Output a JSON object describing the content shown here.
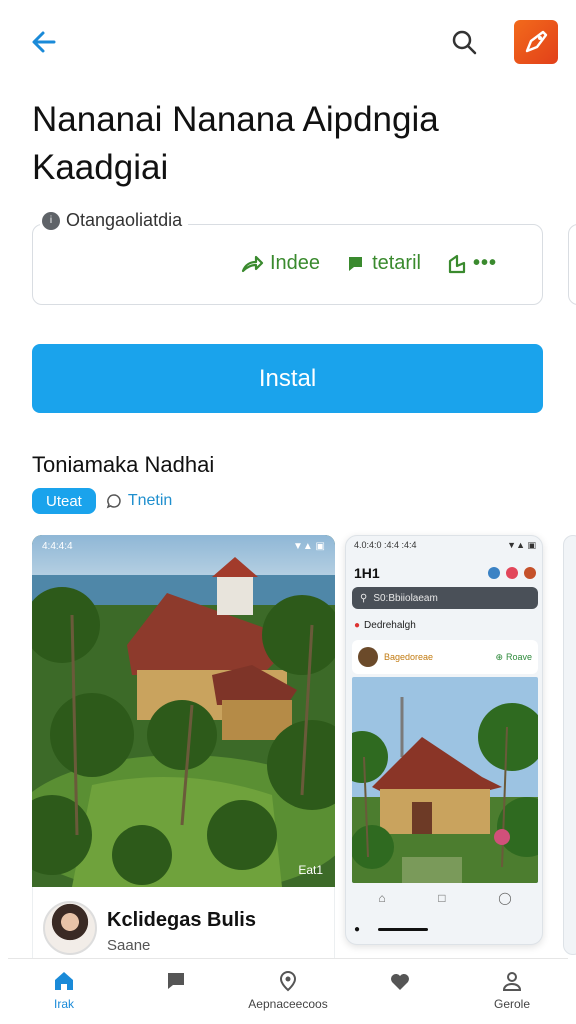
{
  "app": {
    "title": "Nananai Nanana Aipdngia Kaadgiai",
    "install_label": "Instal"
  },
  "info_card": {
    "label": "Otangaoliatdia",
    "actions": [
      {
        "label": "Indee",
        "icon": "share-icon"
      },
      {
        "label": "tetaril",
        "icon": "flag-icon"
      },
      {
        "label": "",
        "icon": "bookmark-icon"
      }
    ],
    "more_label": "•••"
  },
  "section": {
    "title": "Toniamaka Nadhai",
    "chips": [
      {
        "label": "Uteat",
        "active": true
      },
      {
        "label": "Tnetin",
        "active": false
      }
    ]
  },
  "screenshot1": {
    "status_left": "4:4:4:4",
    "status_right": "▼▲ ▣",
    "caption": "Eat1",
    "creator_name": "Kclidegas Bulis",
    "creator_sub": "Saane"
  },
  "screenshot2": {
    "status_left": "4.0:4:0 :4:4 :4:4",
    "status_right": "▼▲ ▣",
    "title": "1H1",
    "search_placeholder": "S0:Bbiiolaeam",
    "section_label": "Dedrehalgh",
    "post_name": "Bagedoreae",
    "post_follow": "Roave"
  },
  "bottom_nav": [
    {
      "label": "Irak",
      "icon": "home-icon",
      "active": true
    },
    {
      "label": "",
      "icon": "chat-icon",
      "active": false
    },
    {
      "label": "Aepnaceecoos",
      "icon": "explore-icon",
      "active": false
    },
    {
      "label": "",
      "icon": "heart-icon",
      "active": false
    },
    {
      "label": "Gerole",
      "icon": "profile-icon",
      "active": false
    }
  ],
  "colors": {
    "accent": "#1aa3ec",
    "action_green": "#3a8a2e",
    "app_icon": "#f26a1b"
  }
}
